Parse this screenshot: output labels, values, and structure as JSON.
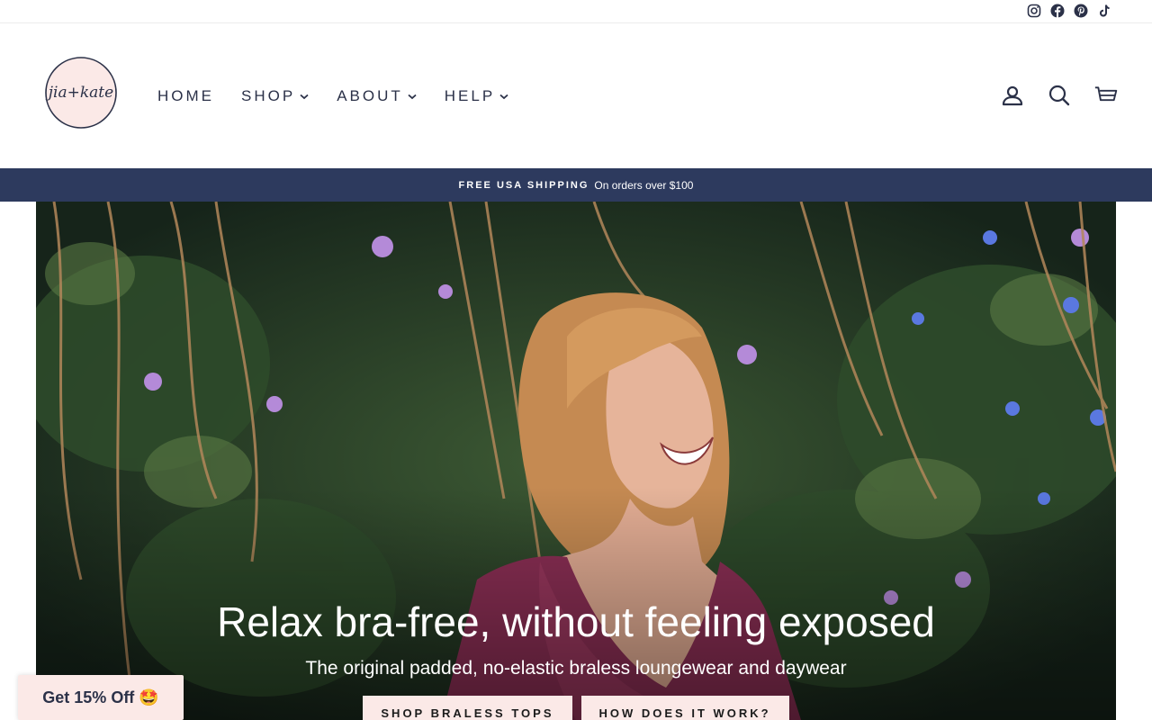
{
  "social": {
    "icons": [
      "instagram-icon",
      "facebook-icon",
      "pinterest-icon",
      "tiktok-icon"
    ]
  },
  "header": {
    "logo_text": "jia+kate",
    "nav": [
      {
        "label": "HOME",
        "has_dropdown": false
      },
      {
        "label": "SHOP",
        "has_dropdown": true
      },
      {
        "label": "ABOUT",
        "has_dropdown": true
      },
      {
        "label": "HELP",
        "has_dropdown": true
      }
    ],
    "icons": [
      "account-icon",
      "search-icon",
      "cart-icon"
    ]
  },
  "announcement": {
    "bold": "FREE USA SHIPPING",
    "text": "On orders over $100"
  },
  "hero": {
    "title": "Relax bra-free, without feeling exposed",
    "subtitle": "The original padded, no-elastic braless loungewear and daywear",
    "buttons": [
      "SHOP BRALESS TOPS",
      "HOW DOES IT WORK?"
    ]
  },
  "popup": {
    "label": "Get 15% Off 🤩"
  },
  "colors": {
    "navy": "#2d3a5e",
    "blush": "#fbe9e7",
    "text": "#2b3148"
  }
}
